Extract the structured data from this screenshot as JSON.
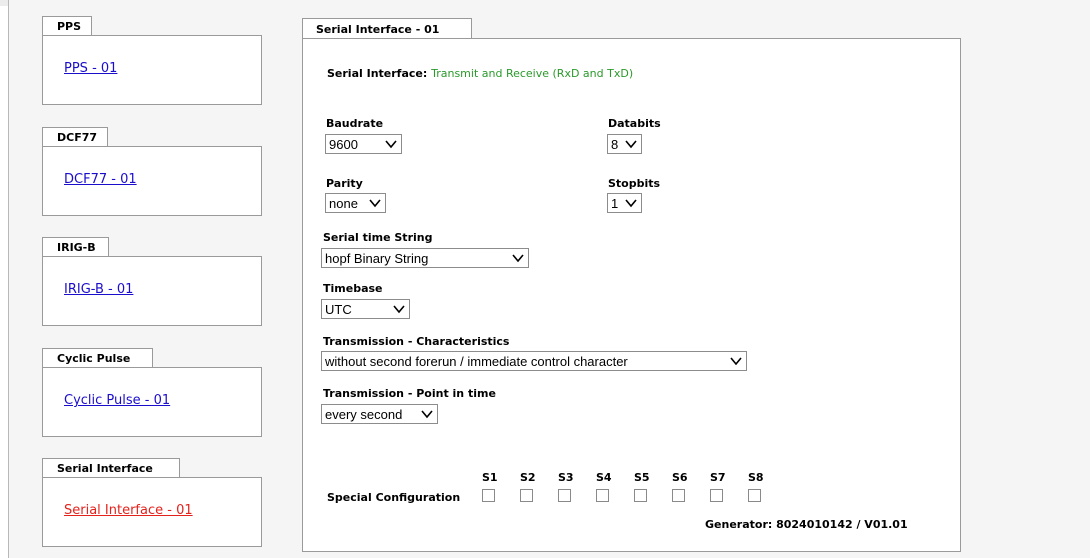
{
  "sidebar": {
    "groups": [
      {
        "title": "PPS",
        "link": "PPS - 01",
        "active": false
      },
      {
        "title": "DCF77",
        "link": "DCF77 - 01",
        "active": false
      },
      {
        "title": "IRIG-B",
        "link": "IRIG-B - 01",
        "active": false
      },
      {
        "title": "Cyclic Pulse",
        "link": "Cyclic Pulse - 01",
        "active": false
      },
      {
        "title": "Serial Interface",
        "link": "Serial Interface - 01",
        "active": true
      }
    ],
    "link_color": "#1a0dcc",
    "active_link_color": "#e4221c"
  },
  "main": {
    "tab_title": "Serial Interface - 01",
    "interface_label": "Serial Interface:",
    "interface_mode": "Transmit and Receive (RxD and TxD)",
    "mode_color": "#2a9a2a",
    "baudrate": {
      "label": "Baudrate",
      "value": "9600"
    },
    "databits": {
      "label": "Databits",
      "value": "8"
    },
    "parity": {
      "label": "Parity",
      "value": "none"
    },
    "stopbits": {
      "label": "Stopbits",
      "value": "1"
    },
    "time_string": {
      "label": "Serial time String",
      "value": "hopf Binary String"
    },
    "timebase": {
      "label": "Timebase",
      "value": "UTC"
    },
    "characteristics": {
      "label": "Transmission - Characteristics",
      "value": "without second forerun / immediate control character"
    },
    "point_in_time": {
      "label": "Transmission - Point in time",
      "value": "every second"
    },
    "special": {
      "label": "Special Configuration",
      "switches": [
        "S1",
        "S2",
        "S3",
        "S4",
        "S5",
        "S6",
        "S7",
        "S8"
      ]
    },
    "generator": "Generator: 8024010142 / V01.01"
  }
}
